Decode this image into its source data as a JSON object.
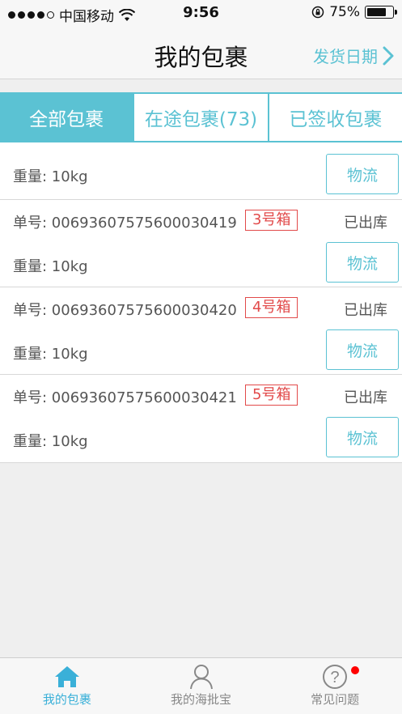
{
  "status_bar": {
    "carrier": "中国移动",
    "time": "9:56",
    "battery": "75%",
    "battery_level": 0.75
  },
  "nav": {
    "title": "我的包裹",
    "action_label": "发货日期"
  },
  "tabs": [
    {
      "label": "全部包裹",
      "active": true
    },
    {
      "label": "在途包裹(73)",
      "active": false
    },
    {
      "label": "已签收包裹",
      "active": false
    }
  ],
  "packages": [
    {
      "number_label": "",
      "box": "",
      "status": "",
      "weight": "重量: 10kg",
      "button": "物流"
    },
    {
      "number_label": "单号: 0069360757560003041 9",
      "box": "3号箱",
      "status": "已出库",
      "weight": "重量: 10kg",
      "button": "物流"
    },
    {
      "number_label": "单号: 00693607575600030420",
      "box": "4号箱",
      "status": "已出库",
      "weight": "重量: 10kg",
      "button": "物流"
    },
    {
      "number_label": "单号: 00693607575600030421",
      "box": "5号箱",
      "status": "已出库",
      "weight": "重量: 10kg",
      "button": "物流"
    }
  ],
  "tabbar": [
    {
      "label": "我的包裹",
      "icon": "home-icon",
      "active": true
    },
    {
      "label": "我的海批宝",
      "icon": "user-icon",
      "active": false
    },
    {
      "label": "常见问题",
      "icon": "help-icon",
      "active": false,
      "badge": true
    }
  ],
  "colors": {
    "accent": "#5bc2d3",
    "tag_red": "#e24a4a",
    "tabbar_active": "#3ab0d8"
  }
}
